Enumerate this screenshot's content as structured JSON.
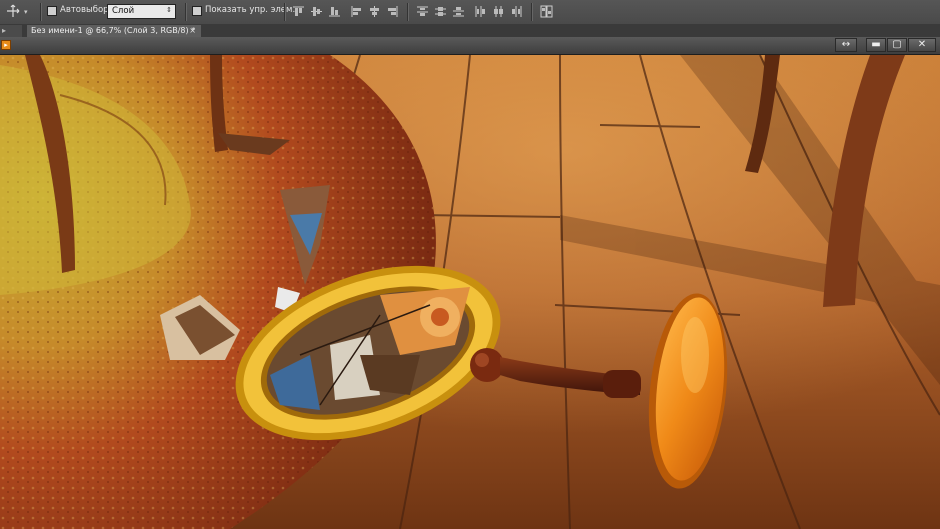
{
  "options_bar": {
    "tool_icon": "move-tool-icon",
    "auto_select_label": "Автовыбор:",
    "auto_select_checked": false,
    "auto_select_value": "Слой",
    "show_transform_label": "Показать упр. элем.",
    "show_transform_checked": false,
    "align_icons": [
      "align-top-icon",
      "align-vcenter-icon",
      "align-bottom-icon",
      "align-left-icon",
      "align-hcenter-icon",
      "align-right-icon"
    ],
    "distribute_icons": [
      "distribute-top-icon",
      "distribute-vcenter-icon",
      "distribute-bottom-icon",
      "distribute-left-icon",
      "distribute-hcenter-icon",
      "distribute-right-icon"
    ],
    "auto_align_icon": "auto-align-icon"
  },
  "document_tab": {
    "title": "Без имени-1 @ 66,7% (Слой 3, RGB/8) *",
    "close_glyph": "×"
  },
  "window_controls": {
    "arrange_icon": "arrange-icon",
    "minimize_icon": "minimize-icon",
    "maximize_icon": "maximize-icon",
    "close_icon": "close-icon"
  },
  "canvas": {
    "description_colors": {
      "floor": "#b8692a",
      "rug": "#b2421f",
      "frame": "#e0a81a",
      "handle": "#6a2a12",
      "disc": "#f09a1a"
    }
  }
}
